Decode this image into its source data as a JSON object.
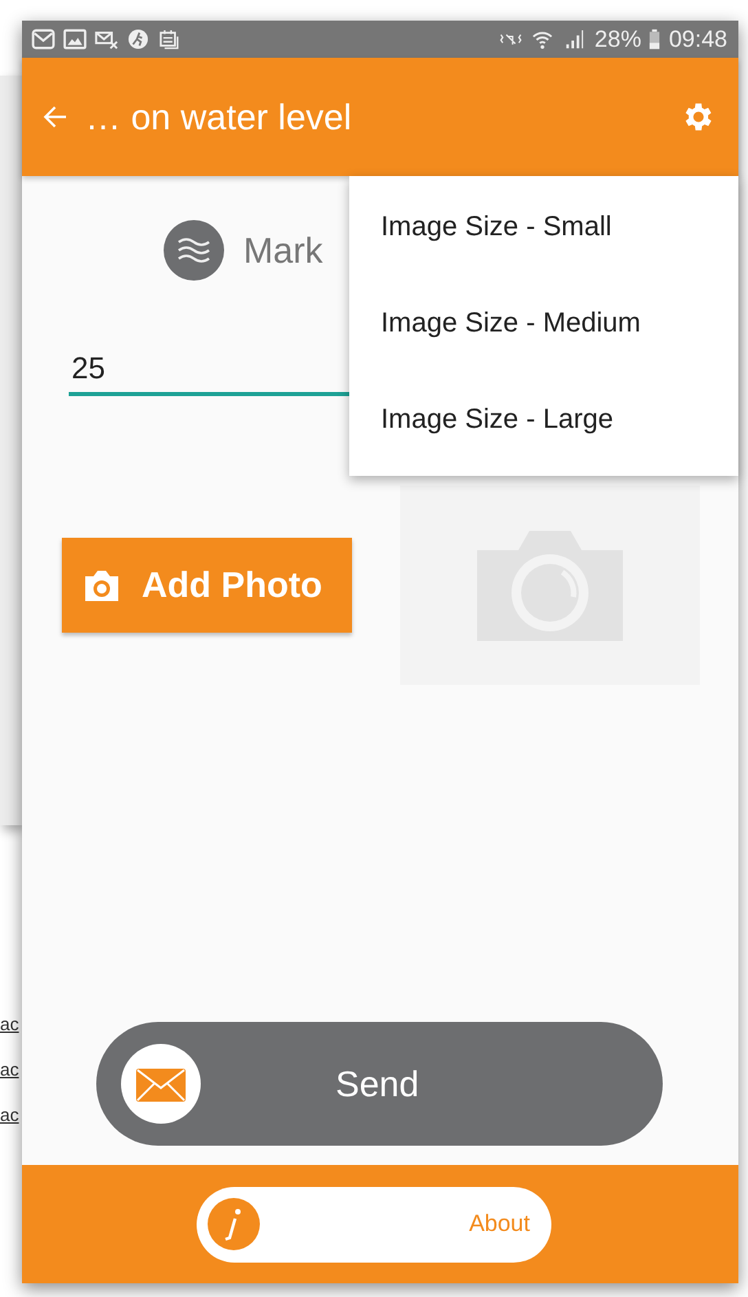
{
  "background_links": [
    "ac",
    "ac",
    "ac"
  ],
  "status_bar": {
    "battery": "28%",
    "time": "09:48"
  },
  "app_bar": {
    "title": "… on water level"
  },
  "header": {
    "label": "Mark"
  },
  "input": {
    "value": "25"
  },
  "add_photo_button": {
    "label": "Add Photo"
  },
  "send_button": {
    "label": "Send"
  },
  "about_button": {
    "label": "About"
  },
  "menu": {
    "items": [
      {
        "label": "Image Size - Small"
      },
      {
        "label": "Image Size - Medium"
      },
      {
        "label": "Image Size - Large"
      }
    ]
  }
}
